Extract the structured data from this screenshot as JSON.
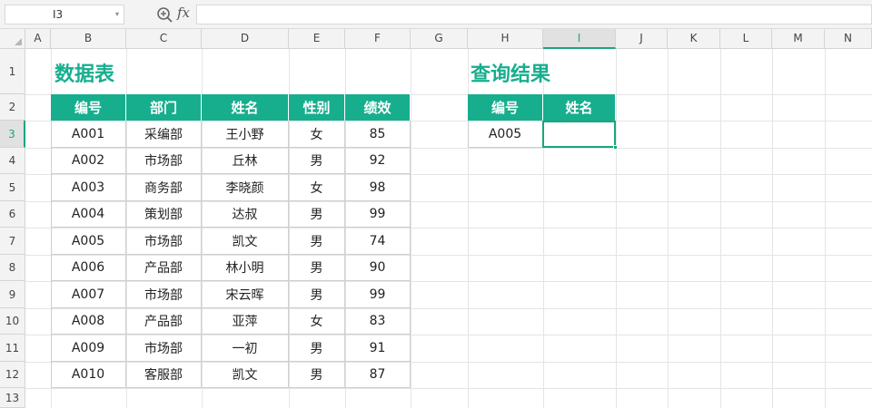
{
  "formula_bar": {
    "name_box": "I3",
    "fx_label": "fx",
    "formula": ""
  },
  "icons": {
    "zoom": "zoom-in-icon",
    "dropdown": "chevron-down-icon"
  },
  "columns": [
    "A",
    "B",
    "C",
    "D",
    "E",
    "F",
    "G",
    "H",
    "I",
    "J",
    "K",
    "L",
    "M",
    "N"
  ],
  "rows": [
    "1",
    "2",
    "3",
    "4",
    "5",
    "6",
    "7",
    "8",
    "9",
    "10",
    "11",
    "12",
    "13"
  ],
  "active_cell": {
    "column": "I",
    "row": "3"
  },
  "colors": {
    "accent": "#17ae8e",
    "selection": "#1ba57f"
  },
  "data_table": {
    "title": "数据表",
    "headers": [
      "编号",
      "部门",
      "姓名",
      "性别",
      "绩效"
    ],
    "rows": [
      [
        "A001",
        "采编部",
        "王小野",
        "女",
        "85"
      ],
      [
        "A002",
        "市场部",
        "丘林",
        "男",
        "92"
      ],
      [
        "A003",
        "商务部",
        "李晓颜",
        "女",
        "98"
      ],
      [
        "A004",
        "策划部",
        "达叔",
        "男",
        "99"
      ],
      [
        "A005",
        "市场部",
        "凯文",
        "男",
        "74"
      ],
      [
        "A006",
        "产品部",
        "林小明",
        "男",
        "90"
      ],
      [
        "A007",
        "市场部",
        "宋云晖",
        "男",
        "99"
      ],
      [
        "A008",
        "产品部",
        "亚萍",
        "女",
        "83"
      ],
      [
        "A009",
        "市场部",
        "一初",
        "男",
        "91"
      ],
      [
        "A010",
        "客服部",
        "凯文",
        "男",
        "87"
      ]
    ]
  },
  "query_table": {
    "title": "查询结果",
    "headers": [
      "编号",
      "姓名"
    ],
    "rows": [
      [
        "A005",
        ""
      ]
    ]
  }
}
